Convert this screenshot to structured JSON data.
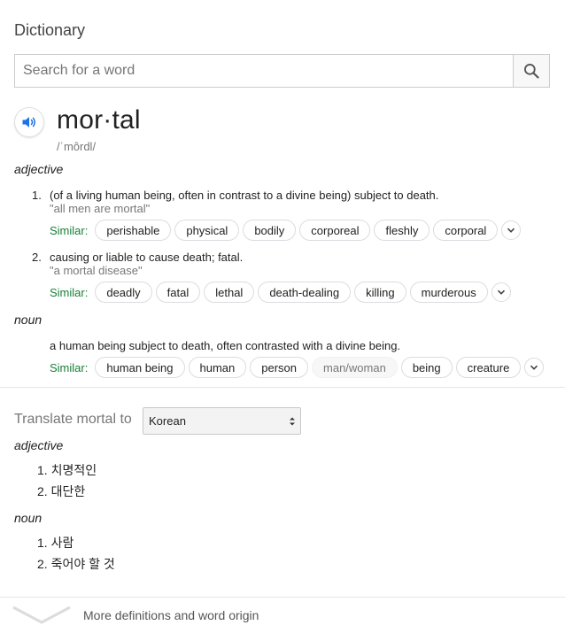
{
  "header": {
    "title": "Dictionary"
  },
  "search": {
    "placeholder": "Search for a word",
    "icon": "search-icon"
  },
  "entry": {
    "word": "mor·tal",
    "phonetic": "/ˈmôrdl/",
    "speaker_icon": "speaker-icon",
    "similar_label": "Similar:",
    "adjective": {
      "pos": "adjective",
      "senses": [
        {
          "number": "1.",
          "definition": "(of a living human being, often in contrast to a divine being) subject to death.",
          "example": "\"all men are mortal\"",
          "similar": [
            "perishable",
            "physical",
            "bodily",
            "corporeal",
            "fleshly",
            "corporal"
          ]
        },
        {
          "number": "2.",
          "definition": "causing or liable to cause death; fatal.",
          "example": "\"a mortal disease\"",
          "similar": [
            "deadly",
            "fatal",
            "lethal",
            "death-dealing",
            "killing",
            "murderous"
          ]
        }
      ]
    },
    "noun": {
      "pos": "noun",
      "definition": "a human being subject to death, often contrasted with a divine being.",
      "similar": [
        "human being",
        "human",
        "person",
        "man/woman",
        "being",
        "creature"
      ]
    }
  },
  "translate": {
    "label": "Translate mortal to",
    "selected_language": "Korean",
    "adjective": {
      "pos": "adjective",
      "items": [
        {
          "number": "1.",
          "text": "치명적인"
        },
        {
          "number": "2.",
          "text": "대단한"
        }
      ]
    },
    "noun": {
      "pos": "noun",
      "items": [
        {
          "number": "1.",
          "text": "사람"
        },
        {
          "number": "2.",
          "text": "죽어야 할 것"
        }
      ]
    }
  },
  "footer": {
    "more_label": "More definitions and word origin"
  },
  "colors": {
    "accent": "#1a73e8",
    "similar": "#188038",
    "muted_text": "#777777",
    "border": "#dadce0"
  }
}
